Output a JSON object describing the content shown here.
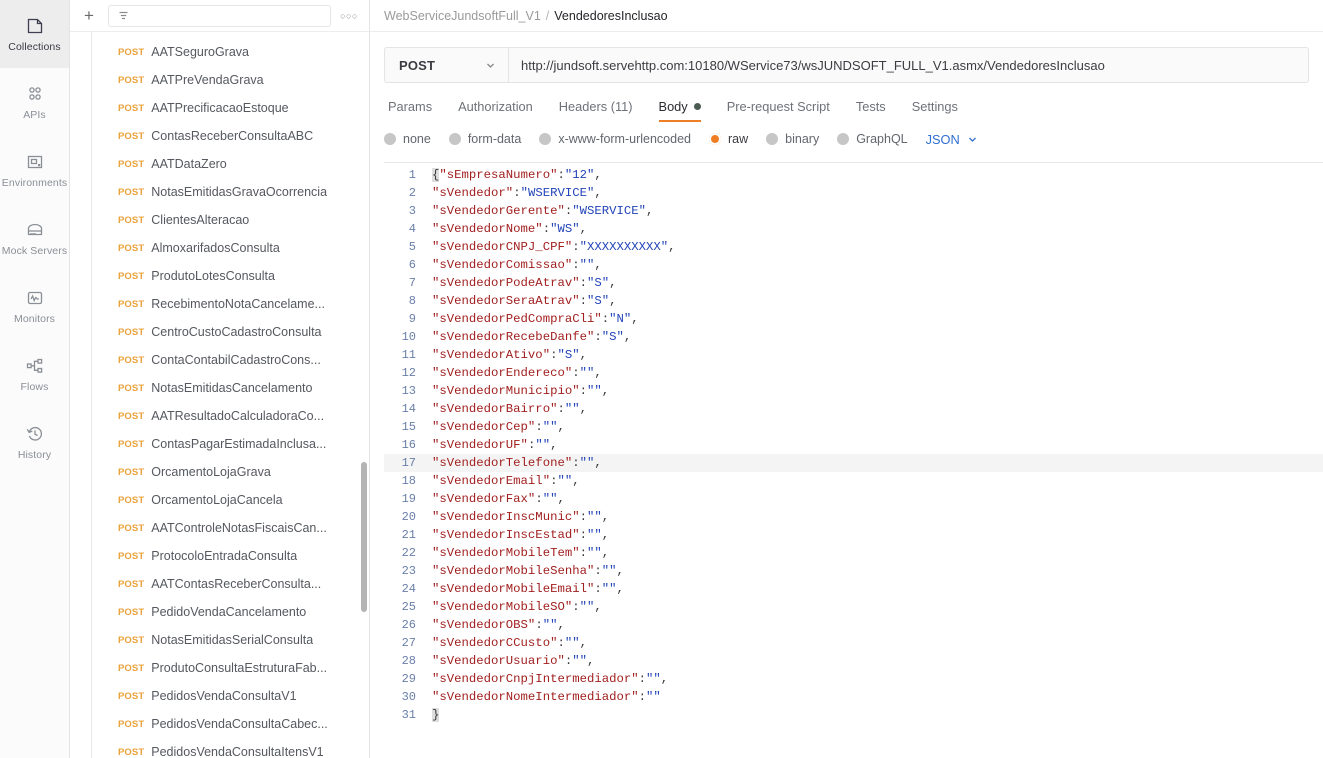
{
  "rail": {
    "items": [
      {
        "label": "Collections",
        "icon": "collections-icon",
        "active": true
      },
      {
        "label": "APIs",
        "icon": "apis-icon",
        "active": false
      },
      {
        "label": "Environments",
        "icon": "environments-icon",
        "active": false
      },
      {
        "label": "Mock Servers",
        "icon": "mock-servers-icon",
        "active": false
      },
      {
        "label": "Monitors",
        "icon": "monitors-icon",
        "active": false
      },
      {
        "label": "Flows",
        "icon": "flows-icon",
        "active": false
      },
      {
        "label": "History",
        "icon": "history-icon",
        "active": false
      }
    ]
  },
  "sidebar": {
    "new_button_label": "+",
    "filter_placeholder": "",
    "filter_value": "",
    "more_actions_label": "○○○",
    "requests": [
      {
        "method": "POST",
        "name": "AATSeguroGrava"
      },
      {
        "method": "POST",
        "name": "AATPreVendaGrava"
      },
      {
        "method": "POST",
        "name": "AATPrecificacaoEstoque"
      },
      {
        "method": "POST",
        "name": "ContasReceberConsultaABC"
      },
      {
        "method": "POST",
        "name": "AATDataZero"
      },
      {
        "method": "POST",
        "name": "NotasEmitidasGravaOcorrencia"
      },
      {
        "method": "POST",
        "name": "ClientesAlteracao"
      },
      {
        "method": "POST",
        "name": "AlmoxarifadosConsulta"
      },
      {
        "method": "POST",
        "name": "ProdutoLotesConsulta"
      },
      {
        "method": "POST",
        "name": "RecebimentoNotaCancelame..."
      },
      {
        "method": "POST",
        "name": "CentroCustoCadastroConsulta"
      },
      {
        "method": "POST",
        "name": "ContaContabilCadastroCons..."
      },
      {
        "method": "POST",
        "name": "NotasEmitidasCancelamento"
      },
      {
        "method": "POST",
        "name": "AATResultadoCalculadoraCo..."
      },
      {
        "method": "POST",
        "name": "ContasPagarEstimadaInclusa..."
      },
      {
        "method": "POST",
        "name": "OrcamentoLojaGrava"
      },
      {
        "method": "POST",
        "name": "OrcamentoLojaCancela"
      },
      {
        "method": "POST",
        "name": "AATControleNotasFiscaisCan..."
      },
      {
        "method": "POST",
        "name": "ProtocoloEntradaConsulta"
      },
      {
        "method": "POST",
        "name": "AATContasReceberConsulta..."
      },
      {
        "method": "POST",
        "name": "PedidoVendaCancelamento"
      },
      {
        "method": "POST",
        "name": "NotasEmitidasSerialConsulta"
      },
      {
        "method": "POST",
        "name": "ProdutoConsultaEstruturaFab..."
      },
      {
        "method": "POST",
        "name": "PedidosVendaConsultaV1"
      },
      {
        "method": "POST",
        "name": "PedidosVendaConsultaCabec..."
      },
      {
        "method": "POST",
        "name": "PedidosVendaConsultaItensV1"
      }
    ]
  },
  "breadcrumb": {
    "parent": "WebServiceJundsoftFull_V1",
    "separator": "/",
    "current": "VendedoresInclusao"
  },
  "request": {
    "method": "POST",
    "url": "http://jundsoft.servehttp.com:10180/WService73/wsJUNDSOFT_FULL_V1.asmx/VendedoresInclusao"
  },
  "tabs": [
    {
      "label": "Params",
      "active": false,
      "dot": false
    },
    {
      "label": "Authorization",
      "active": false,
      "dot": false
    },
    {
      "label": "Headers (11)",
      "active": false,
      "dot": false
    },
    {
      "label": "Body",
      "active": true,
      "dot": true
    },
    {
      "label": "Pre-request Script",
      "active": false,
      "dot": false
    },
    {
      "label": "Tests",
      "active": false,
      "dot": false
    },
    {
      "label": "Settings",
      "active": false,
      "dot": false
    }
  ],
  "body_types": [
    {
      "label": "none",
      "selected": false
    },
    {
      "label": "form-data",
      "selected": false
    },
    {
      "label": "x-www-form-urlencoded",
      "selected": false
    },
    {
      "label": "raw",
      "selected": true
    },
    {
      "label": "binary",
      "selected": false
    },
    {
      "label": "GraphQL",
      "selected": false
    }
  ],
  "body_format": {
    "label": "JSON"
  },
  "colors": {
    "accent_orange": "#ef7d24",
    "method_post": "#eaa23b",
    "link_blue": "#2f6fd0",
    "json_key": "#a11f1f",
    "json_value": "#2244b8",
    "line_number": "#6a7fa8"
  },
  "editor": {
    "highlighted_line": 17,
    "lines": [
      {
        "n": 1,
        "brace": "{",
        "key": "\"sEmpresaNumero\"",
        "value": "\"12\"",
        "comma": ","
      },
      {
        "n": 2,
        "key": "\"sVendedor\"",
        "value": "\"WSERVICE\"",
        "comma": ","
      },
      {
        "n": 3,
        "key": "\"sVendedorGerente\"",
        "value": "\"WSERVICE\"",
        "comma": ","
      },
      {
        "n": 4,
        "key": "\"sVendedorNome\"",
        "value": "\"WS\"",
        "comma": ","
      },
      {
        "n": 5,
        "key": "\"sVendedorCNPJ_CPF\"",
        "value": "\"XXXXXXXXXX\"",
        "comma": ","
      },
      {
        "n": 6,
        "key": "\"sVendedorComissao\"",
        "value": "\"\"",
        "comma": ","
      },
      {
        "n": 7,
        "key": "\"sVendedorPodeAtrav\"",
        "value": "\"S\"",
        "comma": ","
      },
      {
        "n": 8,
        "key": "\"sVendedorSeraAtrav\"",
        "value": "\"S\"",
        "comma": ","
      },
      {
        "n": 9,
        "key": "\"sVendedorPedCompraCli\"",
        "value": "\"N\"",
        "comma": ","
      },
      {
        "n": 10,
        "key": "\"sVendedorRecebeDanfe\"",
        "value": "\"S\"",
        "comma": ","
      },
      {
        "n": 11,
        "key": "\"sVendedorAtivo\"",
        "value": "\"S\"",
        "comma": ","
      },
      {
        "n": 12,
        "key": "\"sVendedorEndereco\"",
        "value": "\"\"",
        "comma": ","
      },
      {
        "n": 13,
        "key": "\"sVendedorMunicipio\"",
        "value": "\"\"",
        "comma": ","
      },
      {
        "n": 14,
        "key": "\"sVendedorBairro\"",
        "value": "\"\"",
        "comma": ","
      },
      {
        "n": 15,
        "key": "\"sVendedorCep\"",
        "value": "\"\"",
        "comma": ","
      },
      {
        "n": 16,
        "key": "\"sVendedorUF\"",
        "value": "\"\"",
        "comma": ","
      },
      {
        "n": 17,
        "key": "\"sVendedorTelefone\"",
        "value": "\"\"",
        "comma": ","
      },
      {
        "n": 18,
        "key": "\"sVendedorEmail\"",
        "value": "\"\"",
        "comma": ","
      },
      {
        "n": 19,
        "key": "\"sVendedorFax\"",
        "value": "\"\"",
        "comma": ","
      },
      {
        "n": 20,
        "key": "\"sVendedorInscMunic\"",
        "value": "\"\"",
        "comma": ","
      },
      {
        "n": 21,
        "key": "\"sVendedorInscEstad\"",
        "value": "\"\"",
        "comma": ","
      },
      {
        "n": 22,
        "key": "\"sVendedorMobileTem\"",
        "value": "\"\"",
        "comma": ","
      },
      {
        "n": 23,
        "key": "\"sVendedorMobileSenha\"",
        "value": "\"\"",
        "comma": ","
      },
      {
        "n": 24,
        "key": "\"sVendedorMobileEmail\"",
        "value": "\"\"",
        "comma": ","
      },
      {
        "n": 25,
        "key": "\"sVendedorMobileSO\"",
        "value": "\"\"",
        "comma": ","
      },
      {
        "n": 26,
        "key": "\"sVendedorOBS\"",
        "value": "\"\"",
        "comma": ","
      },
      {
        "n": 27,
        "key": "\"sVendedorCCusto\"",
        "value": "\"\"",
        "comma": ","
      },
      {
        "n": 28,
        "key": "\"sVendedorUsuario\"",
        "value": "\"\"",
        "comma": ","
      },
      {
        "n": 29,
        "key": "\"sVendedorCnpjIntermediador\"",
        "value": "\"\"",
        "comma": ","
      },
      {
        "n": 30,
        "key": "\"sVendedorNomeIntermediador\"",
        "value": "\"\"",
        "comma": ""
      },
      {
        "n": 31,
        "closebrace": "}"
      }
    ]
  }
}
